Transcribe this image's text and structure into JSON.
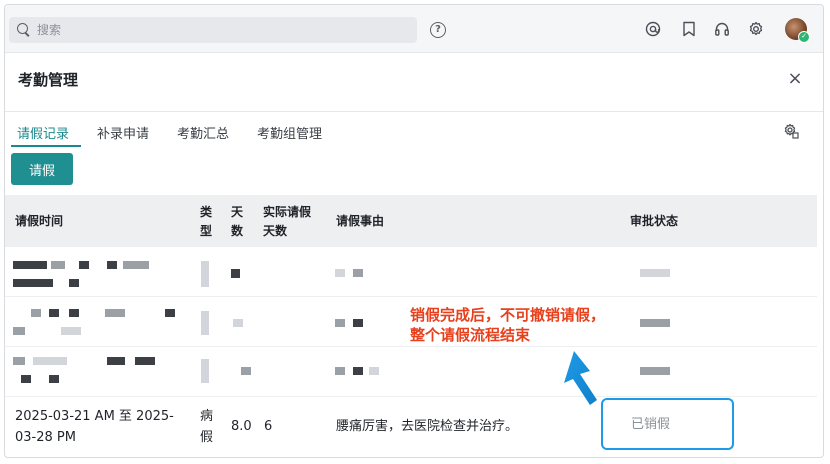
{
  "topbar": {
    "search_placeholder": "搜索",
    "help_icon": "help-circle-icon",
    "right_icons": [
      "at-icon",
      "bookmark-icon",
      "headset-icon",
      "gear-icon"
    ],
    "avatar": "user-avatar"
  },
  "dialog": {
    "title": "考勤管理",
    "close_icon": "close-icon"
  },
  "tabs": [
    {
      "label": "请假记录",
      "active": true
    },
    {
      "label": "补录申请",
      "active": false
    },
    {
      "label": "考勤汇总",
      "active": false
    },
    {
      "label": "考勤组管理",
      "active": false
    }
  ],
  "toolbar": {
    "leave_button": "请假"
  },
  "table": {
    "headers": {
      "time": "请假时间",
      "type_line1": "类",
      "type_line2": "型",
      "days_line1": "天",
      "days_line2": "数",
      "actual_line1": "实际请假",
      "actual_line2": "天数",
      "reason": "请假事由",
      "status": "审批状态"
    },
    "visible_row": {
      "time_line1": "2025-03-21 AM 至 2025-",
      "time_line2": "03-28 PM",
      "type_line1": "病",
      "type_line2": "假",
      "days": "8.0",
      "actual_days": "6",
      "reason": "腰痛厉害，去医院检查并治疗。",
      "status": "已销假"
    }
  },
  "annotation": {
    "line1": "销假完成后，不可撤销请假，",
    "line2": "整个请假流程结束"
  },
  "colors": {
    "accent": "#1f8f92",
    "annotation": "#e8401c",
    "highlight": "#1e9be8"
  }
}
